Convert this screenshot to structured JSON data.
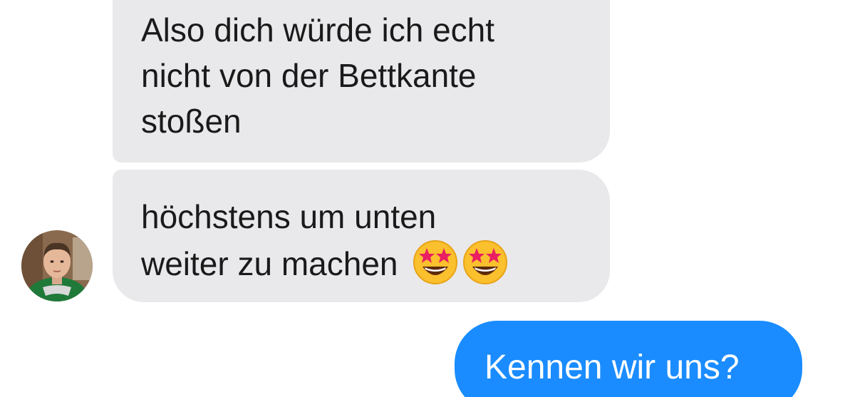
{
  "messages": {
    "incoming_1": {
      "lines": [
        "Also dich würde ich echt",
        "nicht von der Bettkante",
        "stoßen"
      ]
    },
    "incoming_2": {
      "lines": [
        "höchstens um unten",
        "weiter zu machen"
      ],
      "emoji": [
        "star-struck-emoji",
        "star-struck-emoji"
      ]
    },
    "outgoing_1": {
      "text": "Kennen wir uns?"
    }
  },
  "contact": {
    "avatar_icon": "person-photo-avatar"
  },
  "colors": {
    "incoming_bubble": "#e9e9eb",
    "outgoing_bubble": "#1a8cff",
    "incoming_text": "#1a1a1a",
    "outgoing_text": "#ffffff"
  }
}
